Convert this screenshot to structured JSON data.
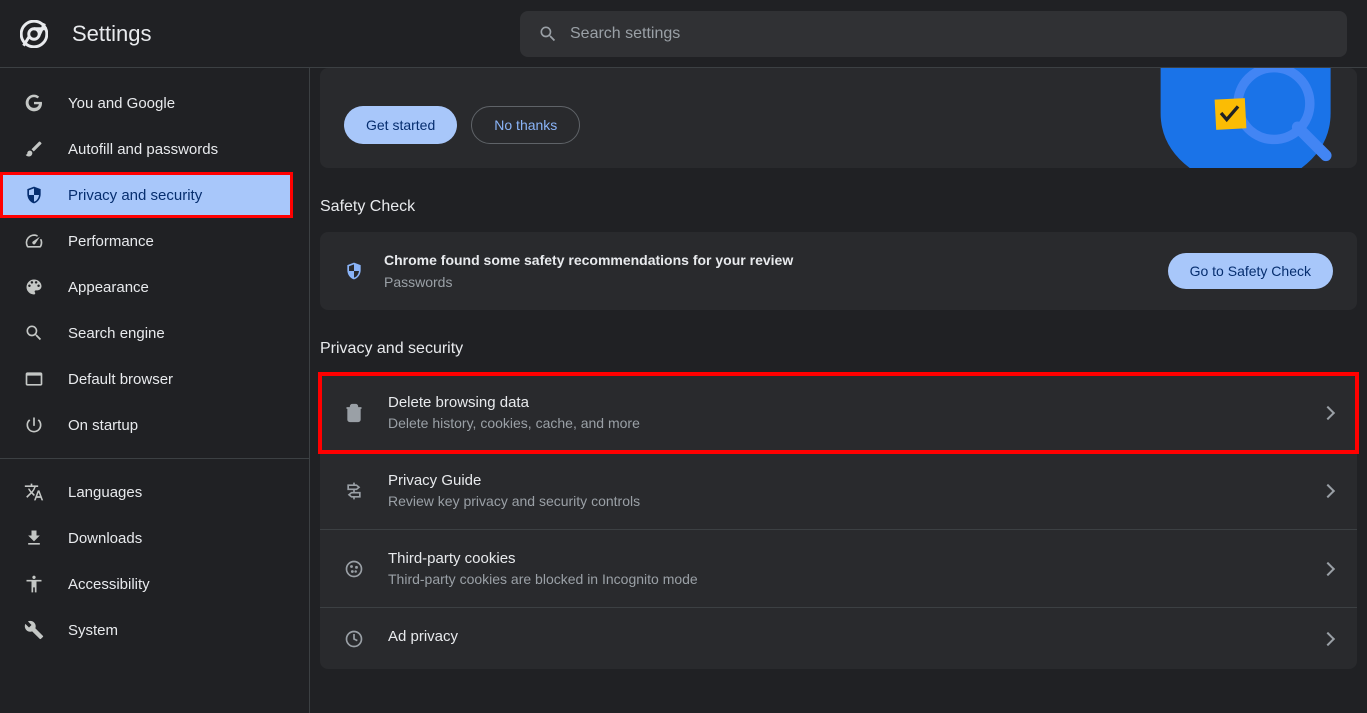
{
  "header": {
    "title": "Settings",
    "search_placeholder": "Search settings"
  },
  "sidebar": {
    "items": [
      {
        "label": "You and Google"
      },
      {
        "label": "Autofill and passwords"
      },
      {
        "label": "Privacy and security"
      },
      {
        "label": "Performance"
      },
      {
        "label": "Appearance"
      },
      {
        "label": "Search engine"
      },
      {
        "label": "Default browser"
      },
      {
        "label": "On startup"
      }
    ],
    "items2": [
      {
        "label": "Languages"
      },
      {
        "label": "Downloads"
      },
      {
        "label": "Accessibility"
      },
      {
        "label": "System"
      }
    ]
  },
  "promo": {
    "get_started": "Get started",
    "no_thanks": "No thanks"
  },
  "safety": {
    "heading": "Safety Check",
    "title": "Chrome found some safety recommendations for your review",
    "subtitle": "Passwords",
    "button": "Go to Safety Check"
  },
  "privacy": {
    "heading": "Privacy and security",
    "rows": [
      {
        "title": "Delete browsing data",
        "sub": "Delete history, cookies, cache, and more"
      },
      {
        "title": "Privacy Guide",
        "sub": "Review key privacy and security controls"
      },
      {
        "title": "Third-party cookies",
        "sub": "Third-party cookies are blocked in Incognito mode"
      },
      {
        "title": "Ad privacy",
        "sub": ""
      }
    ]
  }
}
